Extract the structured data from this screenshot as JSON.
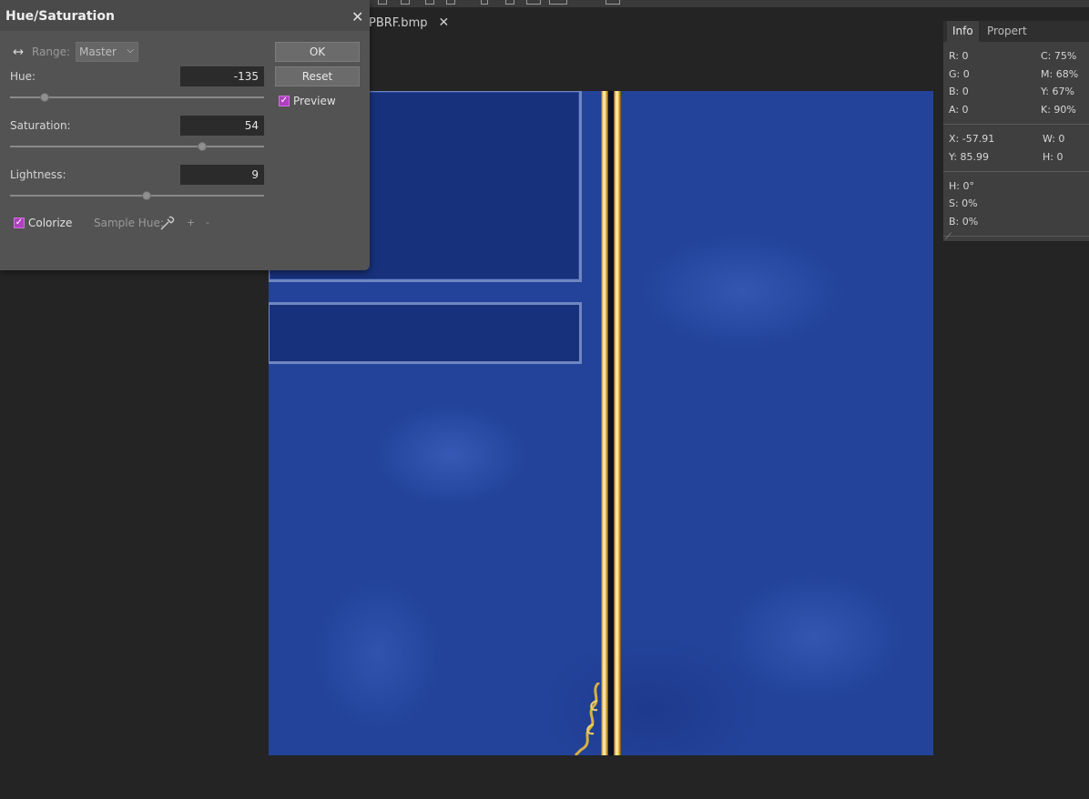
{
  "document": {
    "tab_name": "PBRF.bmp",
    "close_glyph": "✕"
  },
  "dialog": {
    "title": "Hue/Saturation",
    "close_glyph": "✕",
    "range_label": "Range:",
    "range_value": "Master",
    "hue_label": "Hue:",
    "hue_value": "-135",
    "saturation_label": "Saturation:",
    "saturation_value": "54",
    "lightness_label": "Lightness:",
    "lightness_value": "9",
    "colorize_label": "Colorize",
    "colorize_checked": true,
    "sample_hue_label": "Sample Hue:",
    "plus": "+",
    "minus": "-",
    "ok_label": "OK",
    "reset_label": "Reset",
    "preview_label": "Preview",
    "preview_checked": true,
    "slider_levels": {
      "hue": 0.14,
      "saturation": 0.76,
      "lightness": 0.54
    }
  },
  "info_panel": {
    "tabs": [
      "Info",
      "Propert"
    ],
    "r": "R: 0",
    "g": "G: 0",
    "b": "B: 0",
    "a": "A: 0",
    "c": "C: 75%",
    "m": "M: 68%",
    "y": "Y: 67%",
    "k": "K: 90%",
    "x": "X: -57.91",
    "y_coord": "Y: 85.99",
    "w": "W: 0",
    "h": "H: 0",
    "hue": "H: 0°",
    "sat": "S: 0%",
    "bri": "B: 0%"
  },
  "colors": {
    "accent": "#b040c0",
    "canvas_blue": "#23439a",
    "gold": "#e8c060"
  }
}
